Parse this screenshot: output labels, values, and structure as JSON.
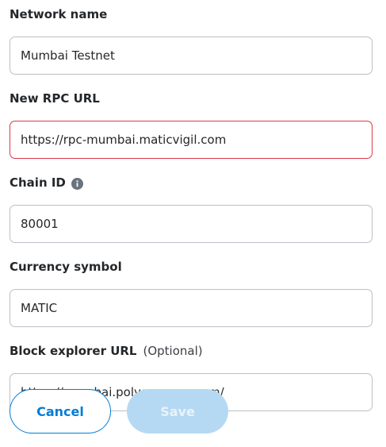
{
  "form": {
    "network_name": {
      "label": "Network name",
      "value": "Mumbai Testnet"
    },
    "rpc_url": {
      "label": "New RPC URL",
      "value": "https://rpc-mumbai.maticvigil.com",
      "state_color": "#d73a49"
    },
    "chain_id": {
      "label": "Chain ID",
      "value": "80001",
      "icon": "info-icon"
    },
    "currency_symbol": {
      "label": "Currency symbol",
      "value": "MATIC"
    },
    "block_explorer": {
      "label": "Block explorer URL",
      "optional": "(Optional)",
      "value": "https://mumbai.polygonscan.com/"
    }
  },
  "buttons": {
    "cancel_label": "Cancel",
    "save_label": "Save",
    "save_disabled": true
  },
  "colors": {
    "accent": "#037dd6",
    "error_border": "#d73a49",
    "disabled_button": "#b6d9f3"
  }
}
